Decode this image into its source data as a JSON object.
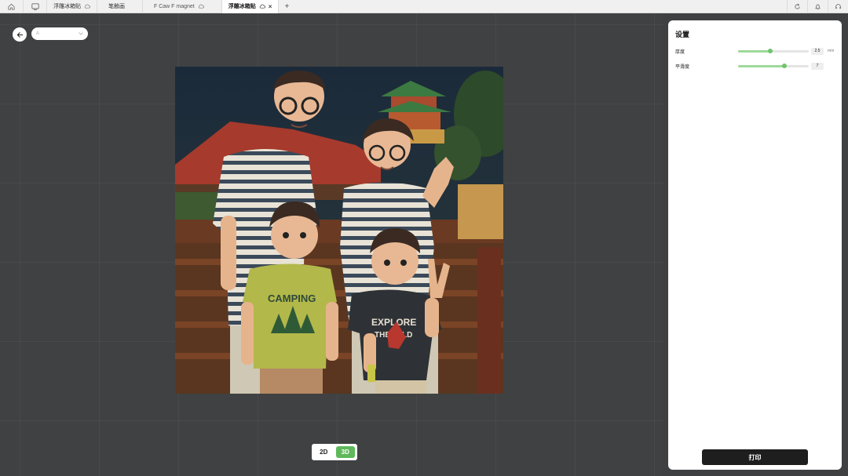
{
  "tabbar": {
    "tabs": [
      {
        "label": "浮雕冰箱贴",
        "cloud": true,
        "active": false
      },
      {
        "label": "笔触画",
        "cloud": false,
        "active": false
      },
      {
        "label": "F Caw F magnet",
        "cloud": true,
        "active": false
      },
      {
        "label": "浮雕冰箱贴",
        "cloud": true,
        "active": true
      }
    ],
    "close_glyph": "×",
    "add_glyph": "+",
    "left_icons": [
      "home-icon",
      "layout-icon"
    ],
    "right_icons": [
      "refresh-icon",
      "bell-icon",
      "headset-icon"
    ]
  },
  "canvas": {
    "model_select_value": "A"
  },
  "view_toggle": {
    "options": [
      "2D",
      "3D"
    ],
    "active": "3D"
  },
  "settings": {
    "title": "设置",
    "thickness": {
      "label": "厚度",
      "value": "2.5",
      "unit": "mm",
      "slider_fraction": 0.45
    },
    "smoothness": {
      "label": "平滑度",
      "value": "7",
      "slider_fraction": 0.65
    },
    "print_label": "打印"
  },
  "colors": {
    "accent": "#5fb85b",
    "slider_fill": "#9fd99a",
    "canvas_bg": "#404142",
    "print_button": "#1e1e1e"
  }
}
